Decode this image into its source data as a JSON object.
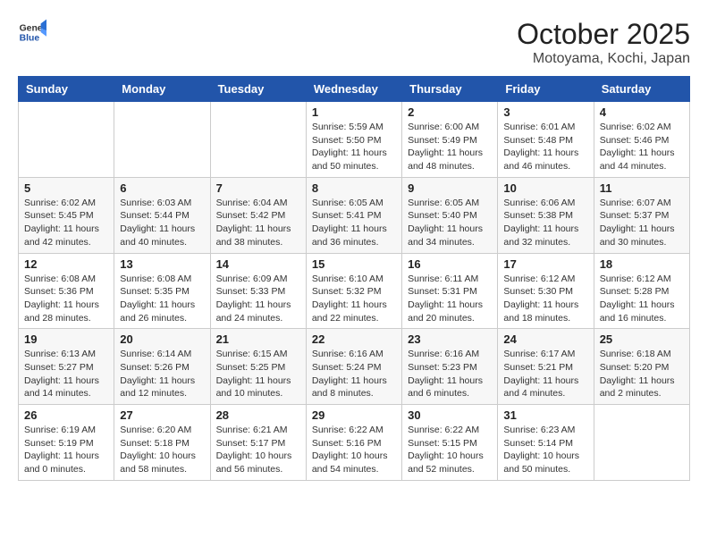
{
  "header": {
    "logo_general": "General",
    "logo_blue": "Blue",
    "month": "October 2025",
    "location": "Motoyama, Kochi, Japan"
  },
  "days_of_week": [
    "Sunday",
    "Monday",
    "Tuesday",
    "Wednesday",
    "Thursday",
    "Friday",
    "Saturday"
  ],
  "weeks": [
    [
      {
        "day": "",
        "info": ""
      },
      {
        "day": "",
        "info": ""
      },
      {
        "day": "",
        "info": ""
      },
      {
        "day": "1",
        "info": "Sunrise: 5:59 AM\nSunset: 5:50 PM\nDaylight: 11 hours\nand 50 minutes."
      },
      {
        "day": "2",
        "info": "Sunrise: 6:00 AM\nSunset: 5:49 PM\nDaylight: 11 hours\nand 48 minutes."
      },
      {
        "day": "3",
        "info": "Sunrise: 6:01 AM\nSunset: 5:48 PM\nDaylight: 11 hours\nand 46 minutes."
      },
      {
        "day": "4",
        "info": "Sunrise: 6:02 AM\nSunset: 5:46 PM\nDaylight: 11 hours\nand 44 minutes."
      }
    ],
    [
      {
        "day": "5",
        "info": "Sunrise: 6:02 AM\nSunset: 5:45 PM\nDaylight: 11 hours\nand 42 minutes."
      },
      {
        "day": "6",
        "info": "Sunrise: 6:03 AM\nSunset: 5:44 PM\nDaylight: 11 hours\nand 40 minutes."
      },
      {
        "day": "7",
        "info": "Sunrise: 6:04 AM\nSunset: 5:42 PM\nDaylight: 11 hours\nand 38 minutes."
      },
      {
        "day": "8",
        "info": "Sunrise: 6:05 AM\nSunset: 5:41 PM\nDaylight: 11 hours\nand 36 minutes."
      },
      {
        "day": "9",
        "info": "Sunrise: 6:05 AM\nSunset: 5:40 PM\nDaylight: 11 hours\nand 34 minutes."
      },
      {
        "day": "10",
        "info": "Sunrise: 6:06 AM\nSunset: 5:38 PM\nDaylight: 11 hours\nand 32 minutes."
      },
      {
        "day": "11",
        "info": "Sunrise: 6:07 AM\nSunset: 5:37 PM\nDaylight: 11 hours\nand 30 minutes."
      }
    ],
    [
      {
        "day": "12",
        "info": "Sunrise: 6:08 AM\nSunset: 5:36 PM\nDaylight: 11 hours\nand 28 minutes."
      },
      {
        "day": "13",
        "info": "Sunrise: 6:08 AM\nSunset: 5:35 PM\nDaylight: 11 hours\nand 26 minutes."
      },
      {
        "day": "14",
        "info": "Sunrise: 6:09 AM\nSunset: 5:33 PM\nDaylight: 11 hours\nand 24 minutes."
      },
      {
        "day": "15",
        "info": "Sunrise: 6:10 AM\nSunset: 5:32 PM\nDaylight: 11 hours\nand 22 minutes."
      },
      {
        "day": "16",
        "info": "Sunrise: 6:11 AM\nSunset: 5:31 PM\nDaylight: 11 hours\nand 20 minutes."
      },
      {
        "day": "17",
        "info": "Sunrise: 6:12 AM\nSunset: 5:30 PM\nDaylight: 11 hours\nand 18 minutes."
      },
      {
        "day": "18",
        "info": "Sunrise: 6:12 AM\nSunset: 5:28 PM\nDaylight: 11 hours\nand 16 minutes."
      }
    ],
    [
      {
        "day": "19",
        "info": "Sunrise: 6:13 AM\nSunset: 5:27 PM\nDaylight: 11 hours\nand 14 minutes."
      },
      {
        "day": "20",
        "info": "Sunrise: 6:14 AM\nSunset: 5:26 PM\nDaylight: 11 hours\nand 12 minutes."
      },
      {
        "day": "21",
        "info": "Sunrise: 6:15 AM\nSunset: 5:25 PM\nDaylight: 11 hours\nand 10 minutes."
      },
      {
        "day": "22",
        "info": "Sunrise: 6:16 AM\nSunset: 5:24 PM\nDaylight: 11 hours\nand 8 minutes."
      },
      {
        "day": "23",
        "info": "Sunrise: 6:16 AM\nSunset: 5:23 PM\nDaylight: 11 hours\nand 6 minutes."
      },
      {
        "day": "24",
        "info": "Sunrise: 6:17 AM\nSunset: 5:21 PM\nDaylight: 11 hours\nand 4 minutes."
      },
      {
        "day": "25",
        "info": "Sunrise: 6:18 AM\nSunset: 5:20 PM\nDaylight: 11 hours\nand 2 minutes."
      }
    ],
    [
      {
        "day": "26",
        "info": "Sunrise: 6:19 AM\nSunset: 5:19 PM\nDaylight: 11 hours\nand 0 minutes."
      },
      {
        "day": "27",
        "info": "Sunrise: 6:20 AM\nSunset: 5:18 PM\nDaylight: 10 hours\nand 58 minutes."
      },
      {
        "day": "28",
        "info": "Sunrise: 6:21 AM\nSunset: 5:17 PM\nDaylight: 10 hours\nand 56 minutes."
      },
      {
        "day": "29",
        "info": "Sunrise: 6:22 AM\nSunset: 5:16 PM\nDaylight: 10 hours\nand 54 minutes."
      },
      {
        "day": "30",
        "info": "Sunrise: 6:22 AM\nSunset: 5:15 PM\nDaylight: 10 hours\nand 52 minutes."
      },
      {
        "day": "31",
        "info": "Sunrise: 6:23 AM\nSunset: 5:14 PM\nDaylight: 10 hours\nand 50 minutes."
      },
      {
        "day": "",
        "info": ""
      }
    ]
  ]
}
